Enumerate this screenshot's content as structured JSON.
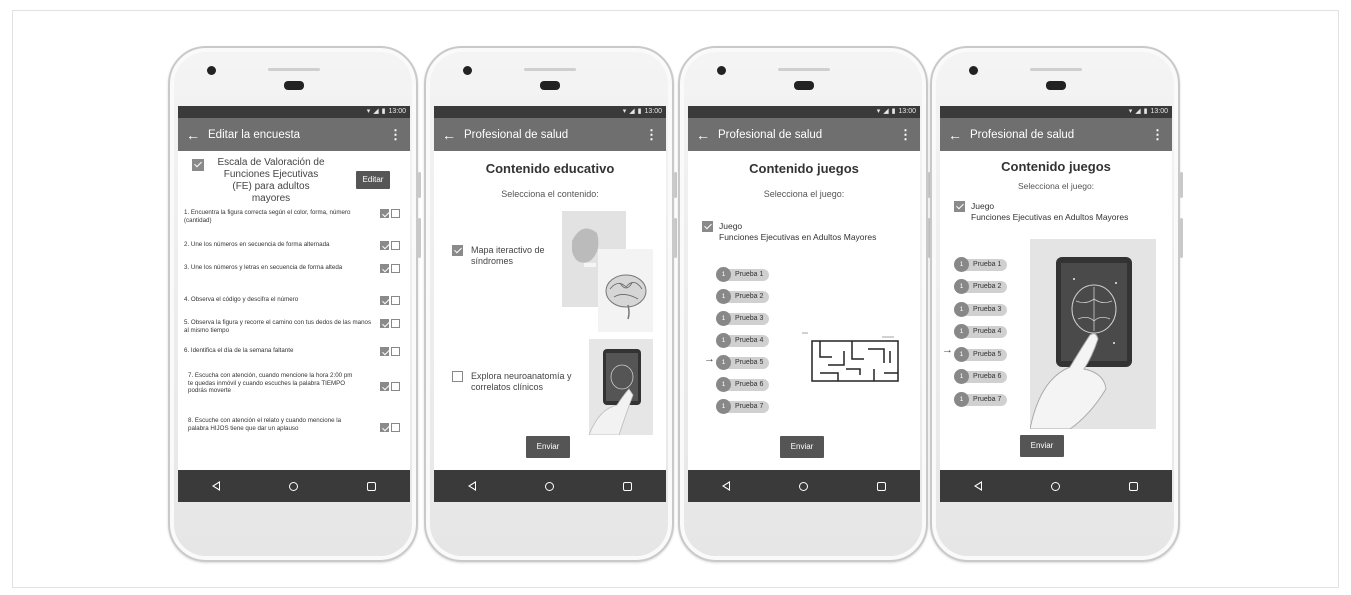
{
  "status": {
    "time": "13:00",
    "wifi_icon": "wifi-icon",
    "signal_icon": "signal-icon",
    "battery_icon": "battery-icon"
  },
  "phones": [
    {
      "appbar_title": "Editar la encuesta",
      "scale_label": "Escala de Valoración de Funciones Ejecutivas (FE) para adultos mayores",
      "edit_button": "Editar",
      "items": [
        "1. Encuentra la figura correcta según el color, forma, número (cantidad)",
        "2. Une los números en secuencia de forma alternada",
        "3. Une los números y letras en secuencia de forma alteda",
        "4. Observa el código y descifra el número",
        "5. Observa la figura y recorre el camino con tus dedos de las manos al mismo tiempo",
        "6. Identifica el día de la semana faltante",
        "7. Escucha con atención, cuando mencione la hora 2:00 pm te quedas inmóvil y cuando escuches la palabra TIEMPO podrás moverte",
        "8. Escuche con atención el relato y cuando mencione  la palabra HIJOS tiene que dar un aplauso"
      ]
    },
    {
      "appbar_title": "Profesional de salud",
      "heading": "Contenido educativo",
      "subheading": "Selecciona el contenido:",
      "option1": "Mapa iteractivo de síndromes",
      "option2": "Explora neuroanatomía y correlatos clínicos",
      "send_button": "Enviar"
    },
    {
      "appbar_title": "Profesional de salud",
      "heading": "Contenido juegos",
      "subheading": "Selecciona el juego:",
      "game_title": "Juego",
      "game_name": "Funciones Ejecutivas en Adultos Mayores",
      "tests": [
        "Prueba 1",
        "Prueba 2",
        "Prueba 3",
        "Prueba 4",
        "Prueba 5",
        "Prueba 6",
        "Prueba 7"
      ],
      "test_number": "1",
      "send_button": "Enviar"
    },
    {
      "appbar_title": "Profesional de salud",
      "heading": "Contenido juegos",
      "subheading": "Selecciona el juego:",
      "game_title": "Juego",
      "game_name": "Funciones Ejecutivas en Adultos Mayores",
      "tests": [
        "Prueba 1",
        "Prueba 2",
        "Prueba 3",
        "Prueba 4",
        "Prueba 5",
        "Prueba 6",
        "Prueba 7"
      ],
      "test_number": "1",
      "send_button": "Enviar"
    }
  ]
}
